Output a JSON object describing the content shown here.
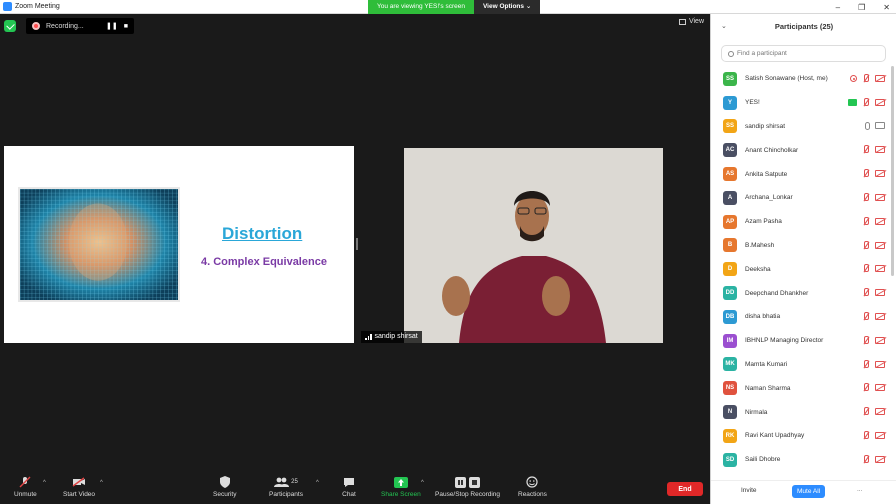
{
  "window": {
    "title": "Zoom Meeting"
  },
  "banner": {
    "message": "You are viewing YES!'s screen",
    "options_label": "View Options"
  },
  "recording": {
    "label": "Recording...",
    "pause": "❚❚",
    "stop": "■"
  },
  "view": {
    "label": "View"
  },
  "slide": {
    "heading": "Distortion",
    "subheading": "4. Complex Equivalence"
  },
  "video": {
    "name": "sandip shirsat"
  },
  "toolbar": {
    "unmute": "Unmute",
    "start_video": "Start Video",
    "security": "Security",
    "participants": "Participants",
    "participants_count": "25",
    "chat": "Chat",
    "share_screen": "Share Screen",
    "pause_recording": "Pause/Stop Recording",
    "reactions": "Reactions",
    "end": "End"
  },
  "panel": {
    "title": "Participants (25)",
    "search_placeholder": "Find a participant",
    "invite": "Invite",
    "mute_all": "Mute All",
    "more": "..."
  },
  "participants": [
    {
      "initials": "SS",
      "name": "Satish Sonawane (Host, me)",
      "color": "#3bb54a",
      "state": "host"
    },
    {
      "initials": "Y",
      "name": "YES!",
      "color": "#2d9ad3",
      "state": "sharing"
    },
    {
      "initials": "SS",
      "name": "sandip shirsat",
      "color": "#f2a516",
      "state": "on"
    },
    {
      "initials": "AC",
      "name": "Anant Chincholkar",
      "color": "#4a4f63",
      "state": "off"
    },
    {
      "initials": "AS",
      "name": "Ankita Satpute",
      "color": "#e6772e",
      "state": "off"
    },
    {
      "initials": "A",
      "name": "Archana_Lonkar",
      "color": "#4a4f63",
      "state": "off"
    },
    {
      "initials": "AP",
      "name": "Azam Pasha",
      "color": "#e6772e",
      "state": "off"
    },
    {
      "initials": "B",
      "name": "B.Mahesh",
      "color": "#e6772e",
      "state": "off"
    },
    {
      "initials": "D",
      "name": "Deeksha",
      "color": "#f2a516",
      "state": "off"
    },
    {
      "initials": "DD",
      "name": "Deepchand Dhankher",
      "color": "#2bb3a3",
      "state": "off"
    },
    {
      "initials": "DB",
      "name": "disha bhatia",
      "color": "#2d9ad3",
      "state": "off"
    },
    {
      "initials": "IM",
      "name": "IBHNLP Managing Director",
      "color": "#9b4fd0",
      "state": "off"
    },
    {
      "initials": "MK",
      "name": "Mamta Kumari",
      "color": "#2bb3a3",
      "state": "off"
    },
    {
      "initials": "NS",
      "name": "Naman Sharma",
      "color": "#e0523e",
      "state": "off"
    },
    {
      "initials": "N",
      "name": "Nirmala",
      "color": "#4a4f63",
      "state": "off"
    },
    {
      "initials": "RK",
      "name": "Ravi Kant Upadhyay",
      "color": "#f2a516",
      "state": "off"
    },
    {
      "initials": "SD",
      "name": "Saili Dhobre",
      "color": "#2bb3a3",
      "state": "off"
    }
  ]
}
